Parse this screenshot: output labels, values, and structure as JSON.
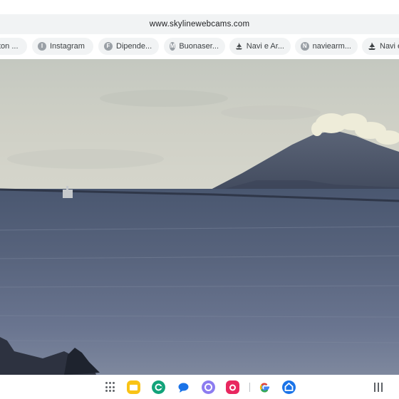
{
  "browser": {
    "url": "www.skylinewebcams.com"
  },
  "bookmarks": [
    {
      "label": "ton ...",
      "icon": "none"
    },
    {
      "label": "Instagram",
      "letter": "I"
    },
    {
      "label": "Dipende...",
      "letter": "F"
    },
    {
      "label": "Buonaser...",
      "letter": "M"
    },
    {
      "label": "Navi e Ar...",
      "icon": "ship-icon"
    },
    {
      "label": "naviearm...",
      "letter": "N"
    },
    {
      "label": "Navi e",
      "icon": "ship-icon"
    }
  ],
  "stream": {
    "description_icon": "webcam-video-frame"
  },
  "taskbar": {
    "apps": [
      {
        "name": "app-drawer-icon"
      },
      {
        "name": "files-icon",
        "color": "#f9c316"
      },
      {
        "name": "phone-app-icon",
        "color": "#12a37a"
      },
      {
        "name": "messages-icon",
        "color": "#1a73e8"
      },
      {
        "name": "bixby-icon",
        "color": "#8c7cf0"
      },
      {
        "name": "camera-icon",
        "color": "#e8275f"
      },
      {
        "name": "google-icon"
      },
      {
        "name": "home-app-icon",
        "color": "#1a73e8"
      }
    ]
  }
}
